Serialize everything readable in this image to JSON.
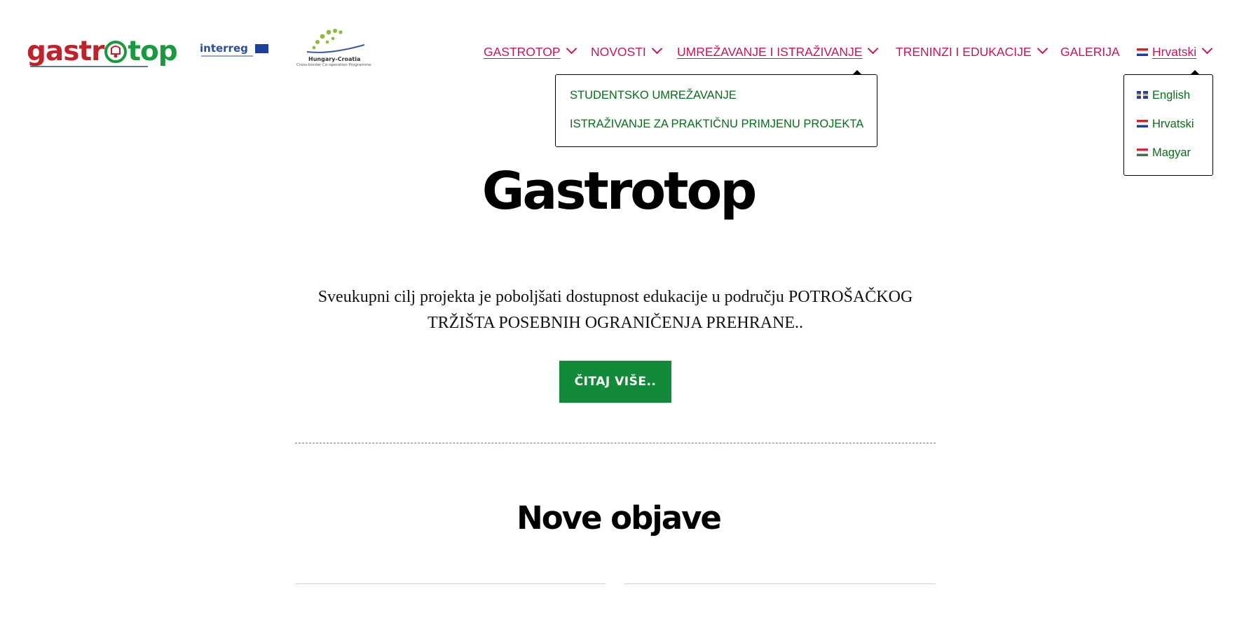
{
  "logos": {
    "gastrotop_left": "gastr",
    "gastrotop_right": "top",
    "interreg": "interreg",
    "hucro_title": "Hungary-Croatia",
    "hucro_subtitle": "Cross-border Co-operation Programme"
  },
  "nav": {
    "items": [
      {
        "label": "GASTROTOP",
        "has_dropdown": true
      },
      {
        "label": "NOVOSTI",
        "has_dropdown": true
      },
      {
        "label": "UMREŽAVANJE I ISTRAŽIVANJE",
        "has_dropdown": true
      },
      {
        "label": "TRENINZI I EDUKACIJE",
        "has_dropdown": true
      },
      {
        "label": "GALERIJA",
        "has_dropdown": false
      },
      {
        "label": "Hrvatski",
        "has_dropdown": true
      }
    ]
  },
  "submenu": {
    "items": [
      {
        "label": "STUDENTSKO UMREŽAVANJE"
      },
      {
        "label": "ISTRAŽIVANJE ZA PRAKTIČNU PRIMJENU PROJEKTA"
      }
    ]
  },
  "language_menu": {
    "items": [
      {
        "label": "English"
      },
      {
        "label": "Hrvatski"
      },
      {
        "label": "Magyar"
      }
    ]
  },
  "hero": {
    "title": "Gastrotop",
    "text_line1": "Sveukupni cilj projekta je poboljšati dostupnost edukacije u području POTROŠAČKOG",
    "text_line2": "TRŽIŠTA POSEBNIH OGRANIČENJA PREHRANE..",
    "cta_label": "ČITAJ VIŠE.."
  },
  "section": {
    "title": "Nove objave"
  },
  "colors": {
    "nav_link": "#c2175b",
    "submenu_link": "#0b6b1c",
    "cta_bg": "#128a3a",
    "logo_red": "#c0222b",
    "logo_green": "#1a9a3e"
  }
}
